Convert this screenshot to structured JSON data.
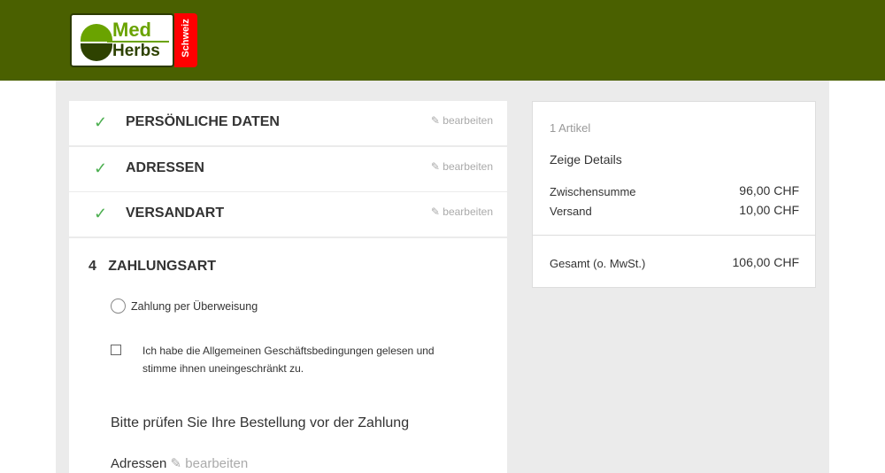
{
  "logo": {
    "med": "Med",
    "herbs": "Herbs",
    "country": "Schweiz"
  },
  "steps": [
    {
      "title": "PERSÖNLICHE DATEN",
      "edit": "bearbeiten"
    },
    {
      "title": "ADRESSEN",
      "edit": "bearbeiten"
    },
    {
      "title": "VERSANDART",
      "edit": "bearbeiten"
    }
  ],
  "payment": {
    "number": "4",
    "title": "ZAHLUNGSART",
    "option": "Zahlung per Überweisung",
    "terms": "Ich habe die Allgemeinen Geschäftsbedingungen gelesen und stimme ihnen uneingeschränkt zu.",
    "review": "Bitte prüfen Sie Ihre Bestellung vor der Zahlung",
    "addresses": "Adressen",
    "addresses_edit": "bearbeiten"
  },
  "summary": {
    "items": "1 Artikel",
    "details": "Zeige Details",
    "subtotal_label": "Zwischensumme",
    "subtotal": "96,00 CHF",
    "shipping_label": "Versand",
    "shipping": "10,00 CHF",
    "total_label": "Gesamt (o. MwSt.)",
    "total": "106,00 CHF"
  }
}
